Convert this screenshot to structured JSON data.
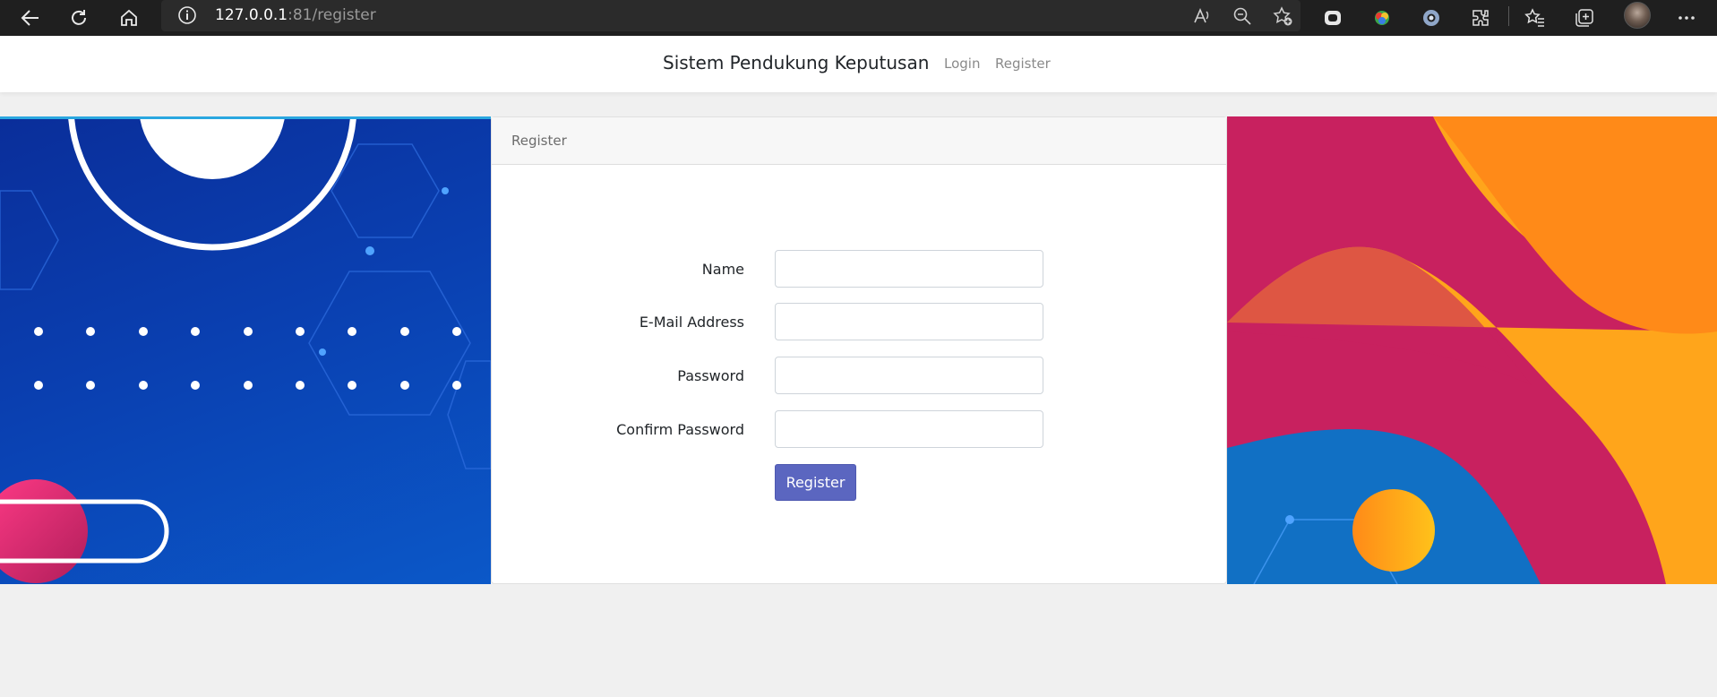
{
  "browser": {
    "url_host": "127.0.0.1",
    "url_rest": ":81/register"
  },
  "app": {
    "brand": "Sistem Pendukung Keputusan",
    "nav": {
      "login": "Login",
      "register": "Register"
    }
  },
  "card": {
    "header": "Register",
    "fields": {
      "name_label": "Name",
      "email_label": "E-Mail Address",
      "password_label": "Password",
      "confirm_label": "Confirm Password"
    },
    "values": {
      "name": "",
      "email": "",
      "password": "",
      "confirm": ""
    },
    "submit_label": "Register"
  },
  "colors": {
    "button": "#5b66c0",
    "left_panel": "#0a3fb0",
    "right_panel_pink": "#c8215f",
    "right_panel_orange": "#ffa51b"
  }
}
